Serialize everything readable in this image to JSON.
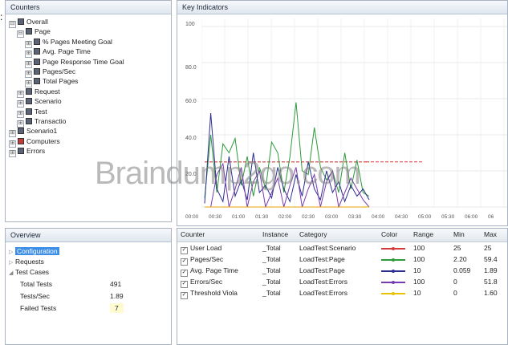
{
  "stray_glyph": ":",
  "counters": {
    "title": "Counters",
    "tree": [
      {
        "label": "Overall",
        "toggle": "⊟",
        "red": false
      },
      {
        "label": "Page",
        "toggle": "⊟",
        "red": false
      },
      {
        "label": "% Pages Meeting Goal",
        "toggle": "⊞",
        "red": false
      },
      {
        "label": "Avg. Page Time",
        "toggle": "⊞",
        "red": false
      },
      {
        "label": "Page Response Time Goal",
        "toggle": "⊞",
        "red": false
      },
      {
        "label": "Pages/Sec",
        "toggle": "⊞",
        "red": false
      },
      {
        "label": "Total Pages",
        "toggle": "⊞",
        "red": false
      },
      {
        "label": "Request",
        "toggle": "⊞",
        "red": false
      },
      {
        "label": "Scenario",
        "toggle": "⊞",
        "red": false
      },
      {
        "label": "Test",
        "toggle": "⊞",
        "red": false
      },
      {
        "label": "Transactio",
        "toggle": "⊞",
        "red": false
      },
      {
        "label": "Scenario1",
        "toggle": "⊞",
        "red": false
      },
      {
        "label": "Computers",
        "toggle": "⊞",
        "red": true
      },
      {
        "label": "Errors",
        "toggle": "⊞",
        "red": false
      }
    ]
  },
  "overview": {
    "title": "Overview",
    "configuration": "Configuration",
    "requests": "Requests",
    "test_cases": "Test Cases",
    "stats": [
      {
        "label": "Total Tests",
        "value": "491"
      },
      {
        "label": "Tests/Sec",
        "value": "1.89"
      },
      {
        "label": "Failed Tests",
        "value": "7"
      }
    ]
  },
  "key_indicators": {
    "title": "Key Indicators",
    "y_ticks": [
      "100",
      "80.0",
      "60.0",
      "40.0",
      "20.0"
    ],
    "x_ticks": [
      "00:00",
      "00:30",
      "01:00",
      "01:30",
      "02:00",
      "02:30",
      "03:00",
      "03:30",
      "04:00",
      "04:30",
      "05:00",
      "05:30",
      "06:00",
      "06"
    ]
  },
  "chart_data": {
    "type": "line",
    "ylim": [
      0,
      100
    ],
    "x": [
      "00:00",
      "00:10",
      "00:20",
      "00:30",
      "00:40",
      "00:50",
      "01:00",
      "01:10",
      "01:20",
      "01:30",
      "01:40",
      "01:50",
      "02:00",
      "02:10",
      "02:20",
      "02:30",
      "02:40",
      "02:50",
      "03:00",
      "03:10",
      "03:20",
      "03:30",
      "03:40",
      "03:50",
      "04:00",
      "04:10",
      "04:20",
      "04:30"
    ],
    "series": [
      {
        "name": "User Load",
        "color": "#d63b3b",
        "values": [
          25,
          25,
          25,
          25,
          25,
          25,
          25,
          25,
          25,
          25,
          25,
          25,
          25,
          25,
          25,
          25,
          25,
          25,
          25,
          25,
          25,
          25,
          25,
          25,
          25,
          25,
          25,
          25
        ]
      },
      {
        "name": "Pages/Sec",
        "color": "#2e9a3a",
        "values": [
          5,
          40,
          8,
          35,
          30,
          38,
          12,
          28,
          6,
          22,
          10,
          36,
          30,
          8,
          28,
          58,
          20,
          18,
          44,
          22,
          15,
          20,
          8,
          30,
          10,
          26,
          8,
          6
        ]
      },
      {
        "name": "Avg. Page Time",
        "color": "#2b2f8f",
        "values": [
          2,
          52,
          10,
          3,
          28,
          6,
          15,
          4,
          30,
          8,
          12,
          5,
          22,
          10,
          3,
          18,
          6,
          25,
          10,
          4,
          20,
          8,
          14,
          3,
          12,
          6,
          10,
          4
        ]
      },
      {
        "name": "Errors/Sec",
        "color": "#7a3ab0",
        "values": [
          0,
          0,
          18,
          24,
          0,
          10,
          22,
          0,
          14,
          20,
          0,
          8,
          16,
          0,
          12,
          22,
          0,
          10,
          18,
          0,
          14,
          20,
          0,
          8,
          16,
          10,
          4,
          0
        ]
      },
      {
        "name": "Threshold Viola",
        "color": "#e6a400",
        "values": [
          0,
          0,
          0,
          0,
          0,
          0,
          0,
          0,
          0,
          0,
          0,
          0,
          0,
          0,
          0,
          0,
          0,
          0,
          0,
          0,
          0,
          0,
          0,
          0,
          0,
          0,
          0,
          0
        ]
      }
    ]
  },
  "counters_table": {
    "headers": [
      "Counter",
      "Instance",
      "Category",
      "Color",
      "Range",
      "Min",
      "Max"
    ],
    "rows": [
      {
        "counter": "User Load",
        "instance": "_Total",
        "category": "LoadTest:Scenario",
        "color": "#d63b3b",
        "range": "100",
        "min": "25",
        "max": "25"
      },
      {
        "counter": "Pages/Sec",
        "instance": "_Total",
        "category": "LoadTest:Page",
        "color": "#2e9a3a",
        "range": "100",
        "min": "2.20",
        "max": "59.4"
      },
      {
        "counter": "Avg. Page Time",
        "instance": "_Total",
        "category": "LoadTest:Page",
        "color": "#2b2f8f",
        "range": "10",
        "min": "0.059",
        "max": "1.89"
      },
      {
        "counter": "Errors/Sec",
        "instance": "_Total",
        "category": "LoadTest:Errors",
        "color": "#7a3ab0",
        "range": "100",
        "min": "0",
        "max": "51.8"
      },
      {
        "counter": "Threshold Viola",
        "instance": "_Total",
        "category": "LoadTest:Errors",
        "color": "#e6c200",
        "range": "10",
        "min": "0",
        "max": "1.60"
      }
    ]
  },
  "watermark": "Braindump2go.com"
}
